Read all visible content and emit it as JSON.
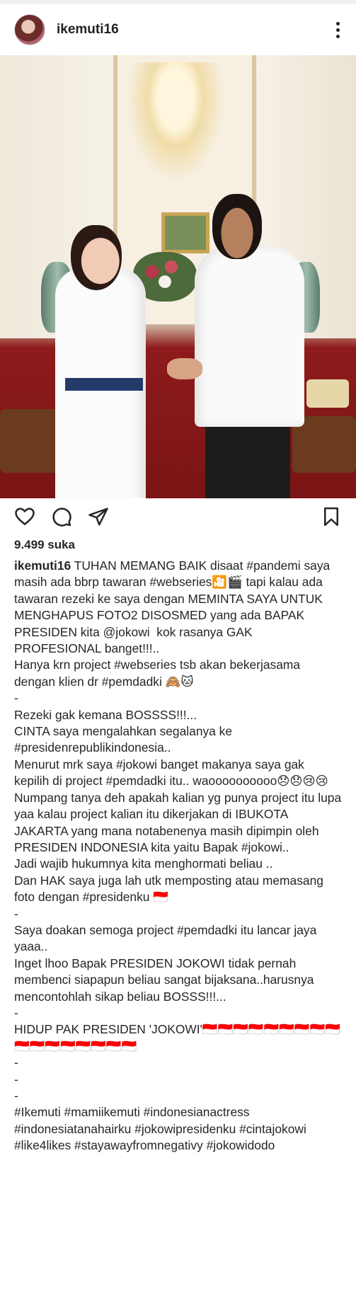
{
  "post": {
    "username": "ikemuti16",
    "likes": "9.499 suka",
    "caption": " TUHAN MEMANG BAIK disaat #pandemi saya masih ada bbrp tawaran #webseries🎦🎬 tapi kalau ada tawaran rezeki ke saya dengan MEMINTA SAYA UNTUK MENGHAPUS FOTO2 DISOSMED yang ada BAPAK PRESIDEN kita @jokowi  kok rasanya GAK PROFESIONAL banget!!!..\nHanya krn project #webseries tsb akan bekerjasama dengan klien dr #pemdadki 🙈🐱\n-\nRezeki gak kemana BOSSSS!!!...\nCINTA saya mengalahkan segalanya ke #presidenrepublikindonesia..\nMenurut mrk saya #jokowi banget makanya saya gak kepilih di project #pemdadki itu.. waoooooooooo😞😞😢😢\nNumpang tanya deh apakah kalian yg punya project itu lupa yaa kalau project kalian itu dikerjakan di IBUKOTA JAKARTA yang mana notabenenya masih dipimpin oleh PRESIDEN INDONESIA kita yaitu Bapak #jokowi..\nJadi wajib hukumnya kita menghormati beliau ..\nDan HAK saya juga lah utk memposting atau memasang foto dengan #presidenku 🇮🇩\n-\nSaya doakan semoga project #pemdadki itu lancar jaya yaaa..\nInget lhoo Bapak PRESIDEN JOKOWI tidak pernah membenci siapapun beliau sangat bijaksana..harusnya mencontohlah sikap beliau BOSSS!!!...\n-\nHIDUP PAK PRESIDEN 'JOKOWI'🇮🇩🇮🇩🇮🇩🇮🇩🇮🇩🇮🇩🇮🇩🇮🇩🇮🇩🇮🇩🇮🇩🇮🇩🇮🇩🇮🇩🇮🇩🇮🇩🇮🇩\n-\n-\n-\n#Ikemuti #mamiikemuti #indonesianactress #indonesiatanahairku #jokowipresidenku #cintajokowi #like4likes #stayawayfromnegativy #jokowidodo"
  },
  "icons": {
    "more": "more-vertical-icon",
    "like": "heart-icon",
    "comment": "comment-icon",
    "share": "send-icon",
    "save": "bookmark-icon"
  },
  "colors": {
    "text": "#262626",
    "background": "#ffffff"
  }
}
